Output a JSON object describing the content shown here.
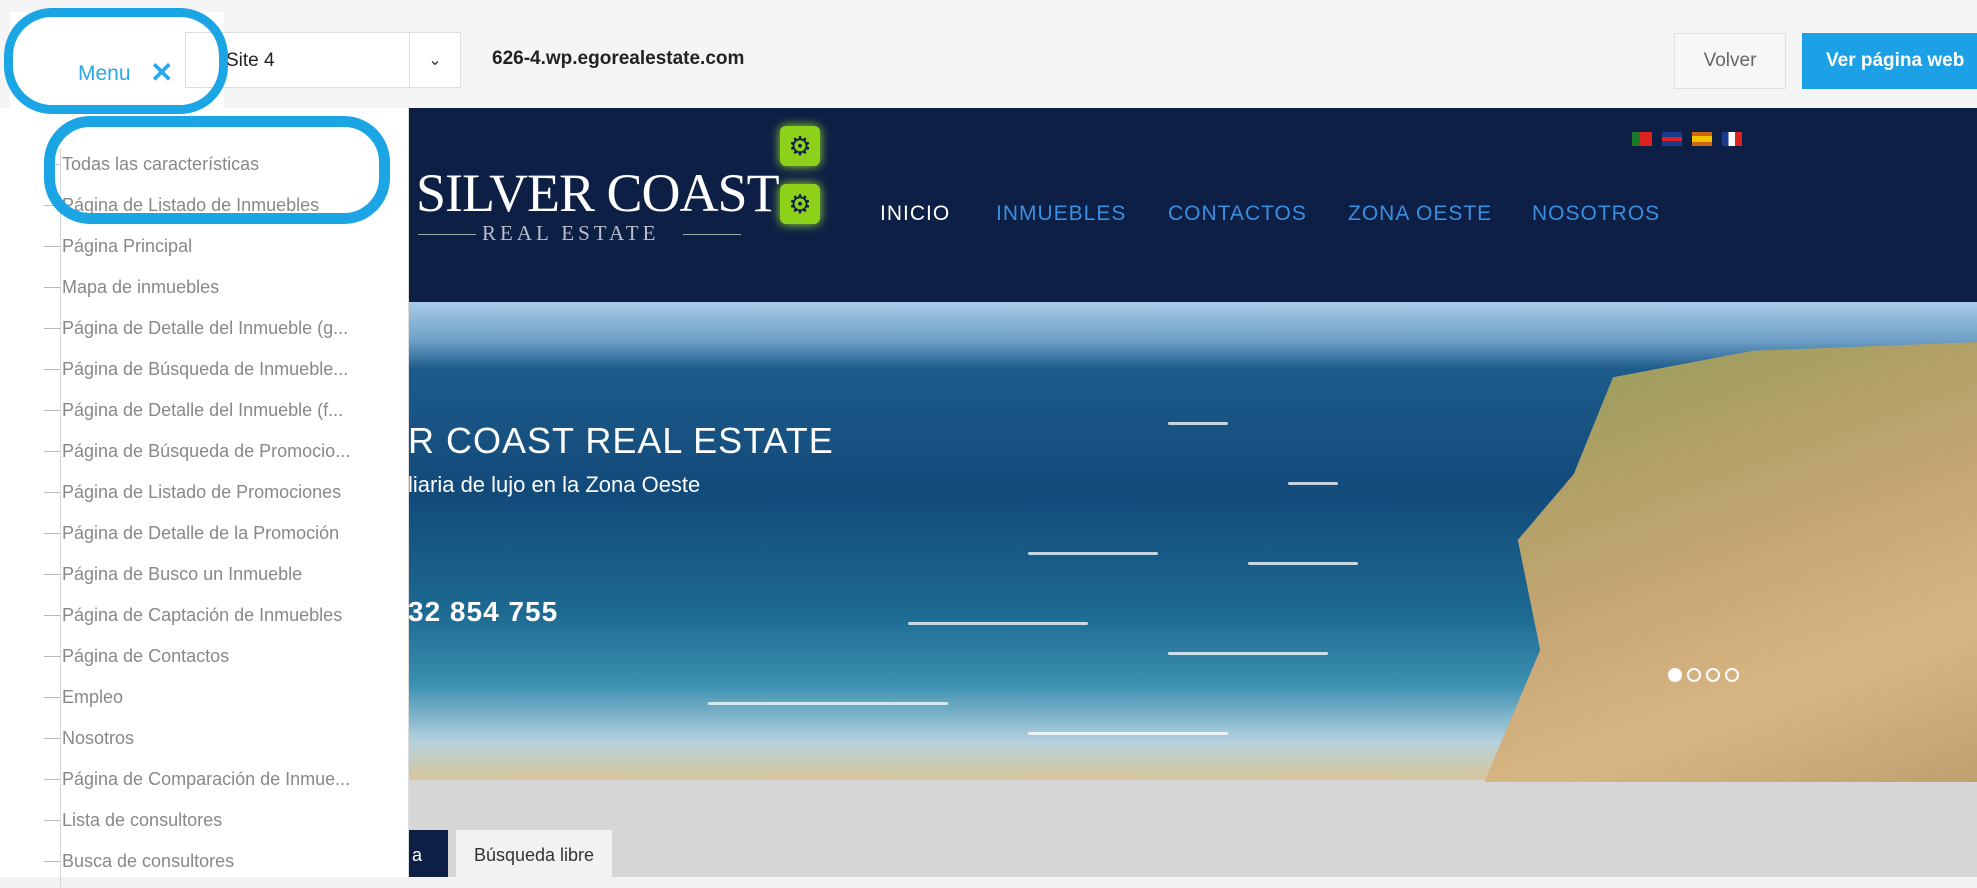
{
  "topbar": {
    "menu_label": "Menu",
    "close_glyph": "✕",
    "site_value": "Site 4",
    "domain": "626-4.wp.egorealestate.com",
    "volver_label": "Volver",
    "ver_label": "Ver página web"
  },
  "sidemenu": {
    "items": [
      "Todas las características",
      "Página de Listado de Inmuebles",
      "Página Principal",
      "Mapa de inmuebles",
      "Página de Detalle del Inmueble (g...",
      "Página de Búsqueda de Inmueble...",
      "Página de Detalle del Inmueble (f...",
      "Página de Búsqueda de Promocio...",
      "Página de Listado de Promociones",
      "Página de Detalle de la Promoción",
      "Página de Busco un Inmueble",
      "Página de Captación de Inmuebles",
      "Página de Contactos",
      "Empleo",
      "Nosotros",
      "Página de Comparación de Inmue...",
      "Lista de consultores",
      "Busca de consultores"
    ]
  },
  "site": {
    "logo_main": "SILVER COAST",
    "logo_sub": "REAL ESTATE",
    "nav": [
      "INICIO",
      "INMUEBLES",
      "CONTACTOS",
      "ZONA OESTE",
      "NOSOTROS"
    ],
    "hero_title": "R COAST REAL ESTATE",
    "hero_subtitle": "liaria de lujo en la Zona Oeste",
    "hero_phone": "32 854 755",
    "tab_dark": "a",
    "tab_light": "Búsqueda libre"
  },
  "colors": {
    "accent": "#1da1e6",
    "header_navy": "#0d1f45",
    "gear_green": "#8ed11a"
  },
  "icons": [
    "close-icon",
    "chevron-down-icon",
    "gear-icon",
    "flag-pt-icon",
    "flag-uk-icon",
    "flag-es-icon",
    "flag-fr-icon"
  ]
}
